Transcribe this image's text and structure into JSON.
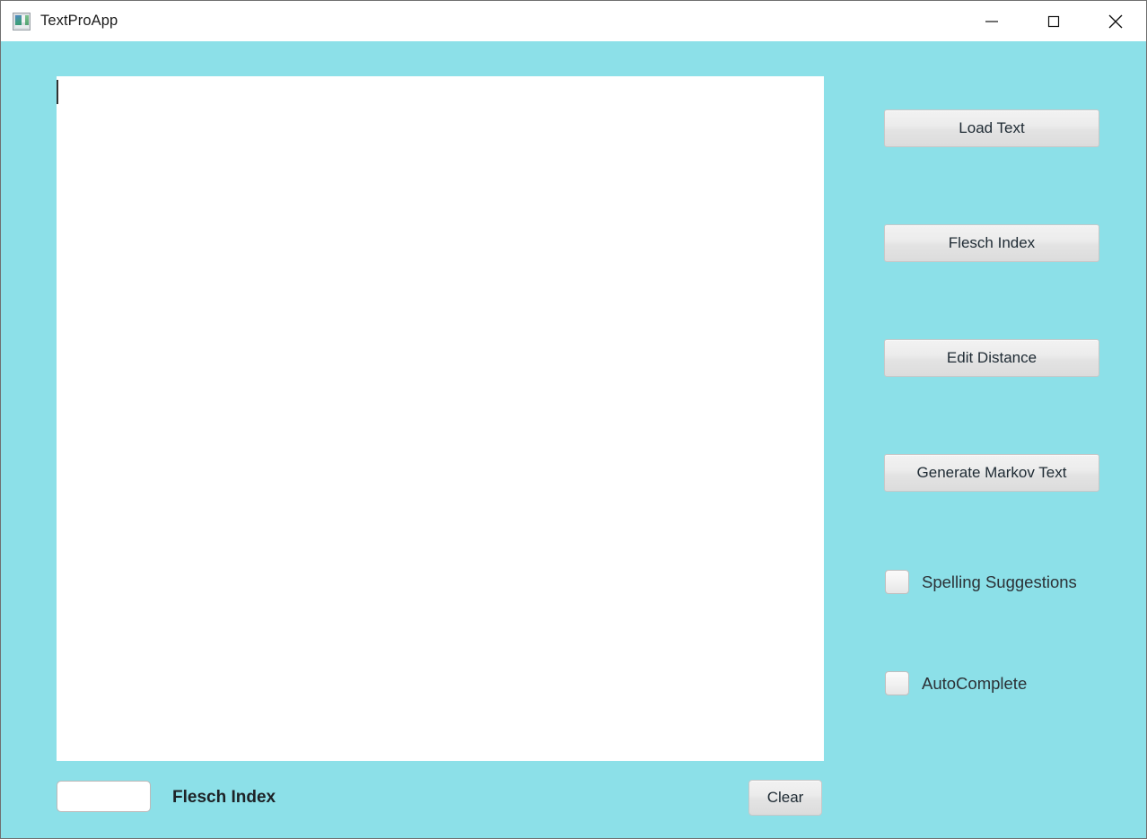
{
  "window": {
    "title": "TextProApp",
    "icon": "app-image-icon",
    "controls": {
      "minimize": "minimize-icon",
      "maximize": "maximize-icon",
      "close": "close-icon"
    }
  },
  "theme": {
    "background": "#8ce0e8",
    "titlebar_background": "#ffffff",
    "button_face": "#ececec",
    "text_color": "#2c3136"
  },
  "editor": {
    "value": "",
    "placeholder": ""
  },
  "sidebar": {
    "buttons": [
      {
        "id": "load-text",
        "label": "Load Text"
      },
      {
        "id": "flesch-index",
        "label": "Flesch Index"
      },
      {
        "id": "edit-distance",
        "label": "Edit Distance"
      },
      {
        "id": "generate-markov-text",
        "label": "Generate Markov Text"
      }
    ],
    "checkboxes": [
      {
        "id": "spelling-suggestions",
        "label": "Spelling Suggestions",
        "checked": false
      },
      {
        "id": "autocomplete",
        "label": "AutoComplete",
        "checked": false
      }
    ]
  },
  "statusbar": {
    "flesch_value": "",
    "flesch_placeholder": "",
    "flesch_label": "Flesch Index",
    "clear_label": "Clear"
  }
}
